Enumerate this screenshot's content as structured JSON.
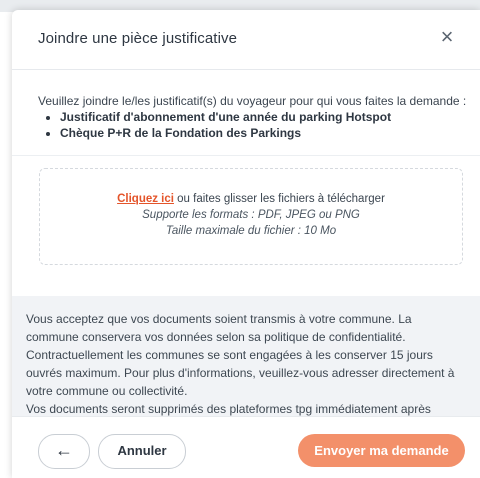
{
  "modal": {
    "title": "Joindre une pièce justificative",
    "close_symbol": "×",
    "intro": "Veuillez joindre le/les justificatif(s) du voyageur pour qui vous faites la demande :",
    "required_docs": [
      "Justificatif d'abonnement d'une année du parking Hotspot",
      "Chèque P+R de la Fondation des Parkings"
    ]
  },
  "dropzone": {
    "link": "Cliquez ici",
    "text": " ou faites glisser les fichiers à télécharger",
    "formats": "Supporte les formats : PDF, JPEG ou PNG",
    "max_size": "Taille maximale du fichier : 10 Mo"
  },
  "consent": {
    "text": "Vous acceptez que vos documents soient transmis à votre commune. La commune conservera vos données selon sa politique de confidentialité. Contractuellement les communes se sont engagées à les conserver 15 jours ouvrés maximum. Pour plus d'informations, veuillez-vous adresser directement à votre commune ou collectivité.",
    "text2": "Vos documents seront supprimés des plateformes tpg immédiatement après"
  },
  "footer": {
    "back_symbol": "←",
    "cancel_label": "Annuler",
    "submit_label": "Envoyer ma demande"
  },
  "colors": {
    "accent": "#f3906a",
    "link": "#e4542a"
  }
}
